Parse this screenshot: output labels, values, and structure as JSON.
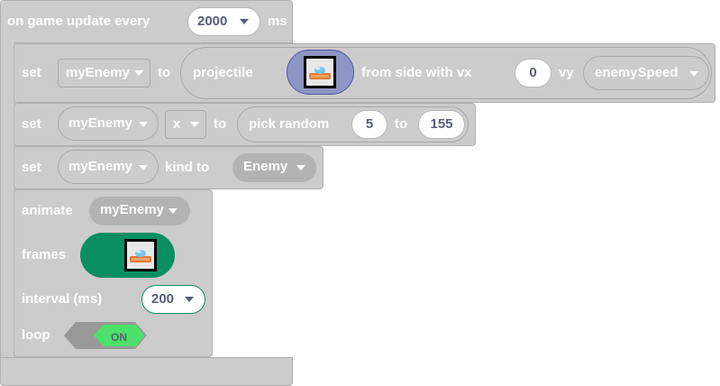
{
  "event": {
    "label": "on game update every",
    "interval_value": "2000",
    "unit": "ms"
  },
  "set_projectile": {
    "set_label": "set",
    "variable": "myEnemy",
    "to_label": "to",
    "projectile_label": "projectile",
    "from_label": "from side with vx",
    "vx_value": "0",
    "vy_label": "vy",
    "vy_variable": "enemySpeed"
  },
  "set_x": {
    "set_label": "set",
    "variable": "myEnemy",
    "property": "x",
    "to_label": "to",
    "pick_label": "pick random",
    "min_value": "5",
    "between_label": "to",
    "max_value": "155"
  },
  "set_kind": {
    "set_label": "set",
    "variable": "myEnemy",
    "kind_label": "kind to",
    "kind_value": "Enemy"
  },
  "animate": {
    "animate_label": "animate",
    "variable": "myEnemy",
    "frames_label": "frames",
    "interval_label": "interval (ms)",
    "interval_value": "200",
    "loop_label": "loop",
    "loop_state": "ON"
  },
  "colors": {
    "block": "#cccccc",
    "block_border": "#b0b0b0",
    "white": "#ffffff",
    "value_text": "#575e75",
    "green_frames": "#0a8f62",
    "toggle_on": "#4ce16a",
    "toggle_shell": "#999999",
    "projectile_pill": "#8f95c4"
  }
}
